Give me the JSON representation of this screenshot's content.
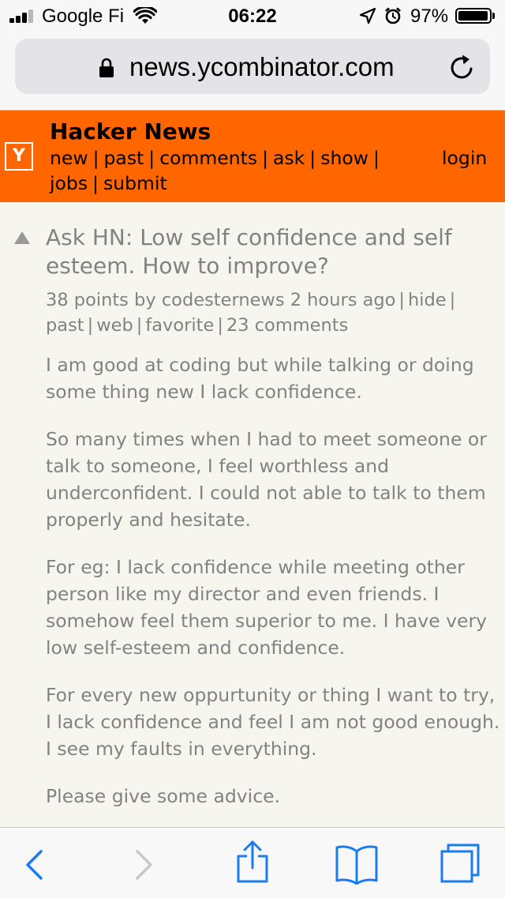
{
  "status_bar": {
    "carrier": "Google Fi",
    "time": "06:22",
    "battery_percent": "97%",
    "battery_level": 0.97,
    "icons": [
      "signal-icon",
      "wifi-icon",
      "location-icon",
      "alarm-icon",
      "battery-icon"
    ]
  },
  "browser": {
    "url": "news.ycombinator.com",
    "icons": [
      "lock-icon",
      "reload-icon"
    ],
    "toolbar_icons": [
      "back-icon",
      "forward-icon",
      "share-icon",
      "bookmarks-icon",
      "tabs-icon"
    ]
  },
  "hn": {
    "logo": "Y",
    "title": "Hacker News",
    "nav": [
      "new",
      "past",
      "comments",
      "ask",
      "show",
      "jobs",
      "submit"
    ],
    "login": "login",
    "accent_color": "#ff6600"
  },
  "story": {
    "title": "Ask HN: Low self confidence and self esteem. How to improve?",
    "points": "38 points",
    "by": "by",
    "author": "codesternews",
    "age": "2 hours ago",
    "actions": [
      "hide",
      "past",
      "web",
      "favorite",
      "23 comments"
    ],
    "paragraphs": [
      "I am good at coding but while talking or doing some thing new I lack confidence.",
      "So many times when I had to meet someone or talk to someone, I feel worthless and underconfident. I could not able to talk to them properly and hesitate.",
      "For eg: I lack confidence while meeting other person like my director and even friends. I somehow feel them superior to me. I have very low self-esteem and confidence.",
      "For every new oppurtunity or thing I want to try, I lack confidence and feel I am not good enough. I see my faults in everything.",
      "Please give some advice."
    ]
  }
}
